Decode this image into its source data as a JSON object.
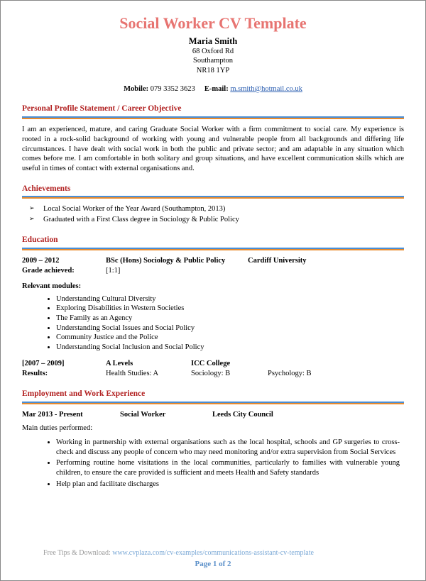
{
  "title": "Social Worker CV Template",
  "name": "Maria Smith",
  "address": {
    "line1": "68 Oxford Rd",
    "line2": "Southampton",
    "line3": "NR18 1YP"
  },
  "contact": {
    "mobile_label": "Mobile:",
    "mobile": "079 3352 3623",
    "email_label": "E-mail:",
    "email": "m.smith@hotmail.co.uk"
  },
  "sections": {
    "profile_heading": "Personal Profile Statement / Career Objective",
    "profile_text": "I am an experienced, mature, and caring Graduate Social Worker with a firm commitment to social care. My experience is rooted in a rock-solid background of working with young and vulnerable people from all backgrounds and differing life circumstances. I have dealt with social work in both the public and private sector; and am adaptable in any situation which comes before me. I am comfortable in both solitary and group situations, and have excellent communication skills which are useful in times of contact with external organisations and.",
    "achievements_heading": "Achievements",
    "achievements": [
      "Local Social Worker of the Year Award (Southampton, 2013)",
      "Graduated with a First Class degree in Sociology & Public Policy"
    ],
    "education_heading": "Education",
    "education": {
      "dates": "2009 – 2012",
      "degree": "BSc (Hons) Sociology & Public Policy",
      "institution": "Cardiff University",
      "grade_label": "Grade achieved:",
      "grade": "[1:1]",
      "modules_label": "Relevant modules:",
      "modules": [
        "Understanding Cultural Diversity",
        "Exploring Disabilities in Western Societies",
        "The Family as an Agency",
        "Understanding Social Issues and Social Policy",
        "Community Justice and the Police",
        "Understanding Social Inclusion and Social Policy"
      ],
      "alevels": {
        "dates": "[2007 – 2009]",
        "qual": "A Levels",
        "institution": "ICC College",
        "results_label": "Results:",
        "r1": "Health Studies: A",
        "r2": "Sociology: B",
        "r3": "Psychology: B"
      }
    },
    "employment_heading": "Employment and Work Experience",
    "employment": {
      "dates": "Mar 2013 - Present",
      "role": "Social Worker",
      "employer": "Leeds City Council",
      "duties_label": "Main duties performed:",
      "duties": [
        "Working in partnership with external organisations such as the local hospital, schools and GP surgeries to cross-check and discuss any people of concern who may need monitoring and/or extra supervision from Social Services",
        "Performing routine home visitations in the local communities, particularly to families with vulnerable young children, to ensure the care provided is sufficient and meets Health and Safety standards",
        "Help plan and facilitate discharges"
      ]
    }
  },
  "footer": {
    "label": "Free Tips & Download: ",
    "link": "www.cvplaza.com/cv-examples/communications-assistant-cv-template"
  },
  "page": "Page 1 of 2"
}
